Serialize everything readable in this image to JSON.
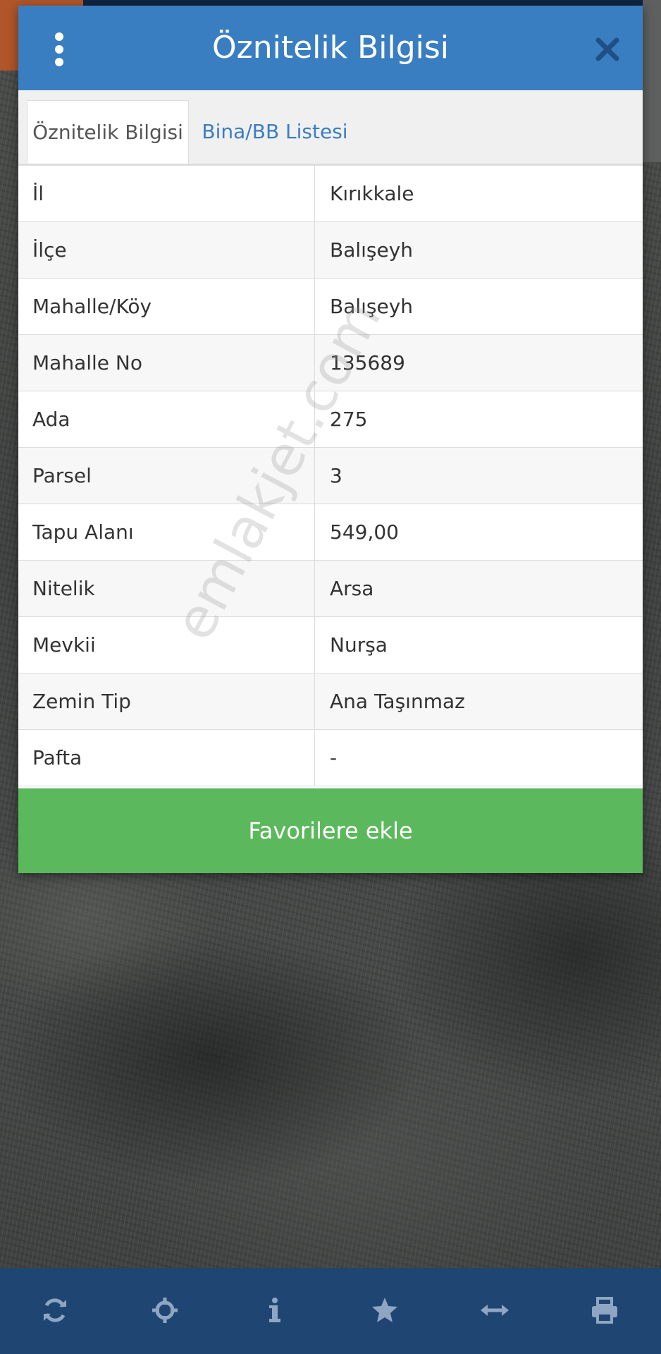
{
  "dialog": {
    "title": "Öznitelik Bilgisi",
    "tabs": [
      {
        "label": "Öznitelik Bilgisi",
        "active": true
      },
      {
        "label": "Bina/BB Listesi",
        "active": false
      }
    ],
    "rows": [
      {
        "key": "İl",
        "value": "Kırıkkale"
      },
      {
        "key": "İlçe",
        "value": "Balışeyh"
      },
      {
        "key": "Mahalle/Köy",
        "value": "Balışeyh"
      },
      {
        "key": "Mahalle No",
        "value": "135689"
      },
      {
        "key": "Ada",
        "value": "275"
      },
      {
        "key": "Parsel",
        "value": "3"
      },
      {
        "key": "Tapu Alanı",
        "value": "549,00"
      },
      {
        "key": "Nitelik",
        "value": "Arsa"
      },
      {
        "key": "Mevkii",
        "value": "Nurşa"
      },
      {
        "key": "Zemin Tip",
        "value": "Ana Taşınmaz"
      },
      {
        "key": "Pafta",
        "value": "-"
      }
    ],
    "favorite_button_label": "Favorilere ekle"
  },
  "watermark": "emlakjet.com",
  "toolbar": {
    "icons": [
      "refresh-icon",
      "crosshair-icon",
      "info-icon",
      "star-icon",
      "measure-icon",
      "print-icon"
    ]
  },
  "colors": {
    "header": "#3a7ec2",
    "tab_link": "#3a7ec2",
    "favorite_button": "#5cb85c",
    "toolbar": "#1f4672",
    "toolbar_icon": "#8fa6c2"
  }
}
